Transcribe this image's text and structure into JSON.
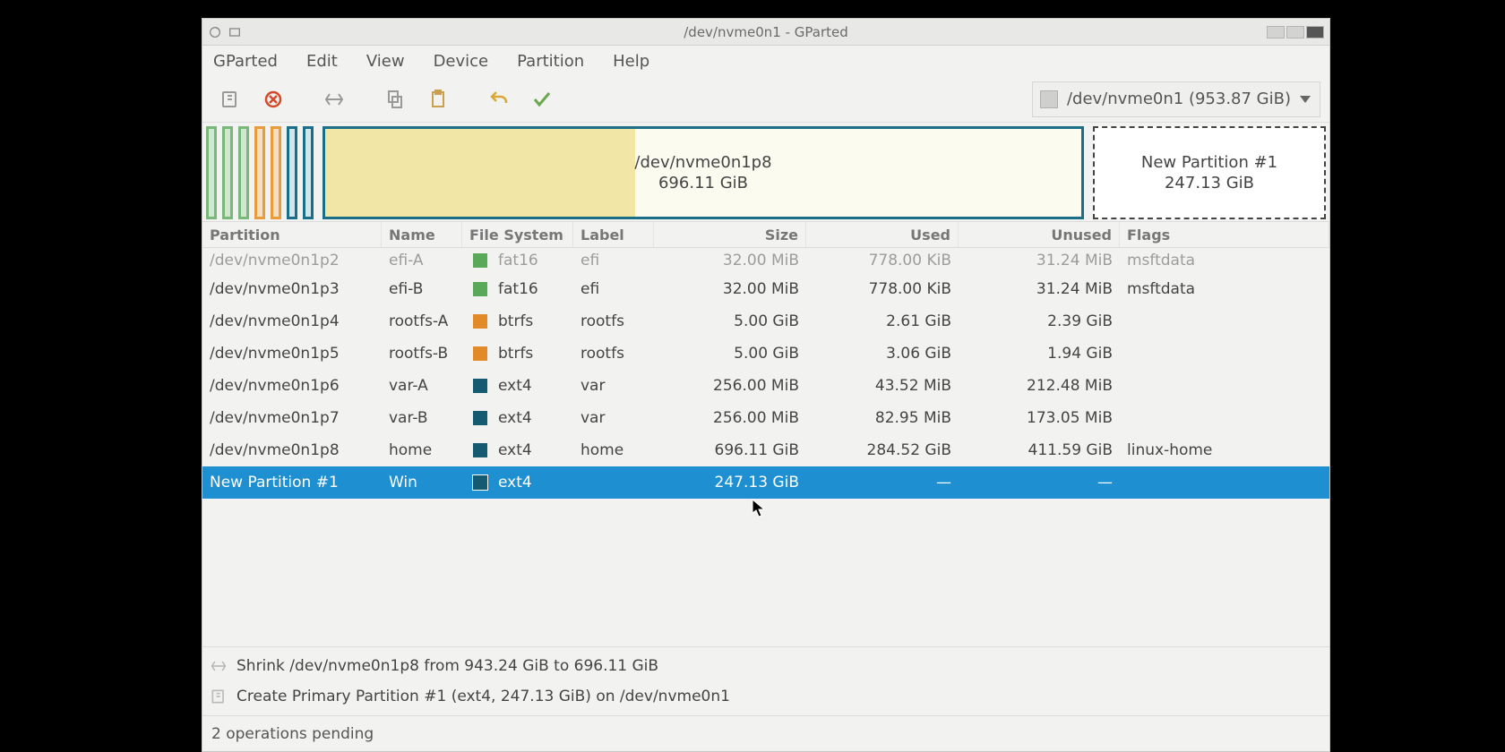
{
  "window": {
    "title": "/dev/nvme0n1 - GParted"
  },
  "menu": [
    "GParted",
    "Edit",
    "View",
    "Device",
    "Partition",
    "Help"
  ],
  "device_selector": "/dev/nvme0n1  (953.87 GiB)",
  "diagram": {
    "main": {
      "name": "/dev/nvme0n1p8",
      "size": "696.11 GiB",
      "used_pct": 41
    },
    "new": {
      "name": "New Partition #1",
      "size": "247.13 GiB"
    }
  },
  "columns": [
    "Partition",
    "Name",
    "File System",
    "Label",
    "Size",
    "Used",
    "Unused",
    "Flags"
  ],
  "fs_colors": {
    "fat16": "fs-fat16",
    "btrfs": "fs-btrfs",
    "ext4": "fs-ext4"
  },
  "partitions": [
    {
      "dev": "/dev/nvme0n1p2",
      "name": "efi-A",
      "fs": "fat16",
      "label": "efi",
      "size": "32.00 MiB",
      "used": "778.00 KiB",
      "unused": "31.24 MiB",
      "flags": "msftdata",
      "cut": true
    },
    {
      "dev": "/dev/nvme0n1p3",
      "name": "efi-B",
      "fs": "fat16",
      "label": "efi",
      "size": "32.00 MiB",
      "used": "778.00 KiB",
      "unused": "31.24 MiB",
      "flags": "msftdata"
    },
    {
      "dev": "/dev/nvme0n1p4",
      "name": "rootfs-A",
      "fs": "btrfs",
      "label": "rootfs",
      "size": "5.00 GiB",
      "used": "2.61 GiB",
      "unused": "2.39 GiB",
      "flags": ""
    },
    {
      "dev": "/dev/nvme0n1p5",
      "name": "rootfs-B",
      "fs": "btrfs",
      "label": "rootfs",
      "size": "5.00 GiB",
      "used": "3.06 GiB",
      "unused": "1.94 GiB",
      "flags": ""
    },
    {
      "dev": "/dev/nvme0n1p6",
      "name": "var-A",
      "fs": "ext4",
      "label": "var",
      "size": "256.00 MiB",
      "used": "43.52 MiB",
      "unused": "212.48 MiB",
      "flags": ""
    },
    {
      "dev": "/dev/nvme0n1p7",
      "name": "var-B",
      "fs": "ext4",
      "label": "var",
      "size": "256.00 MiB",
      "used": "82.95 MiB",
      "unused": "173.05 MiB",
      "flags": ""
    },
    {
      "dev": "/dev/nvme0n1p8",
      "name": "home",
      "fs": "ext4",
      "label": "home",
      "size": "696.11 GiB",
      "used": "284.52 GiB",
      "unused": "411.59 GiB",
      "flags": "linux-home"
    },
    {
      "dev": "New Partition #1",
      "name": "Win",
      "fs": "ext4",
      "label": "",
      "size": "247.13 GiB",
      "used": "—",
      "unused": "—",
      "flags": "",
      "selected": true
    }
  ],
  "operations": [
    {
      "icon": "resize",
      "text": "Shrink /dev/nvme0n1p8 from 943.24 GiB to 696.11 GiB"
    },
    {
      "icon": "new",
      "text": "Create Primary Partition #1 (ext4, 247.13 GiB) on /dev/nvme0n1"
    }
  ],
  "status": "2 operations pending",
  "stripes": [
    "fat16",
    "fat16",
    "fat16",
    "btrfs",
    "btrfs",
    "ext4",
    "ext4"
  ]
}
